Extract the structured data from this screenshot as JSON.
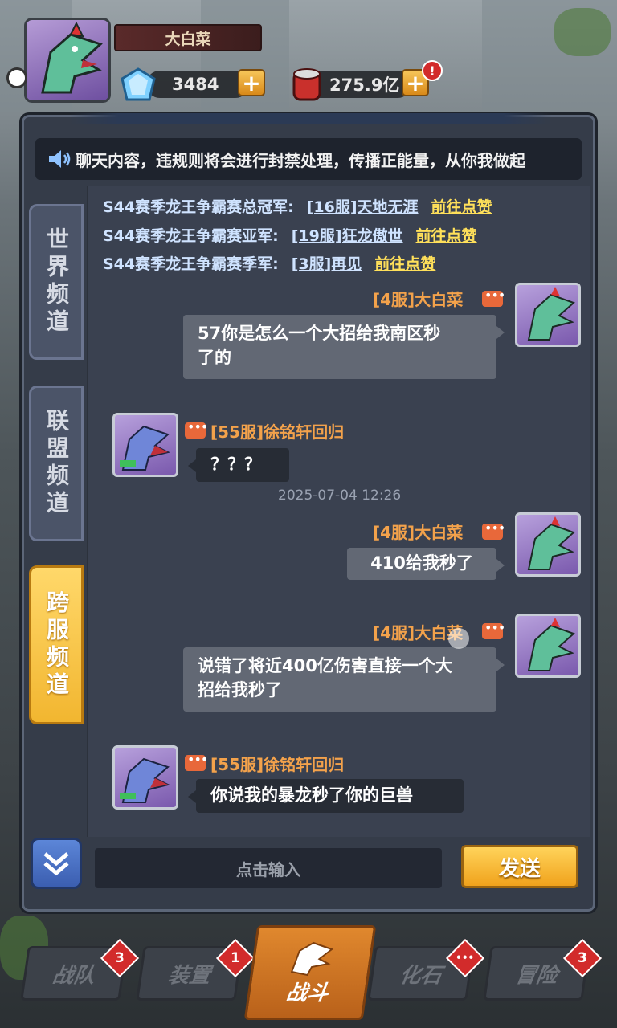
{
  "header": {
    "player_name": "大白菜",
    "gems": "3484",
    "gold": "275.9亿"
  },
  "marquee": {
    "text": "聊天内容，违规则将会进行封禁处理，传播正能量，从你我做起"
  },
  "tabs": [
    {
      "label": "世界频道"
    },
    {
      "label": "联盟频道"
    },
    {
      "label": "跨服频道"
    }
  ],
  "system_lines": [
    {
      "title": "S44赛季龙王争霸赛总冠军:",
      "server": "[16服]天地无涯",
      "action": "前往点赞"
    },
    {
      "title": "S44赛季龙王争霸赛亚军:",
      "server": "[19服]狂龙傲世",
      "action": "前往点赞"
    },
    {
      "title": "S44赛季龙王争霸赛季军:",
      "server": "[3服]再见",
      "action": "前往点赞"
    }
  ],
  "messages": [
    {
      "sender": "[4服]大白菜",
      "text_line1": "57你是怎么一个大招给我南区秒",
      "text_line2": "了的"
    },
    {
      "sender": "[55服]徐铭轩回归",
      "text": "？？？"
    },
    {
      "sender": "[4服]大白菜",
      "text": "410给我秒了"
    },
    {
      "sender": "[4服]大白菜",
      "text_line1": "说错了将近400亿伤害直接一个大",
      "text_line2": "招给我秒了"
    },
    {
      "sender": "[55服]徐铭轩回归",
      "text": "你说我的暴龙秒了你的巨兽"
    }
  ],
  "timestamp": "2025-07-04 12:26",
  "input": {
    "placeholder": "点击输入"
  },
  "send_label": "发送",
  "nav": [
    {
      "label": "战队",
      "badge": "3"
    },
    {
      "label": "装置",
      "badge": "1"
    },
    {
      "label": "战斗"
    },
    {
      "label": "化石",
      "badge": "•••"
    },
    {
      "label": "冒险",
      "badge": "3"
    }
  ],
  "colors": {
    "accent_orange": "#f3a24b",
    "link_yellow": "#ffe05a",
    "active_tab": "#f2b630"
  }
}
